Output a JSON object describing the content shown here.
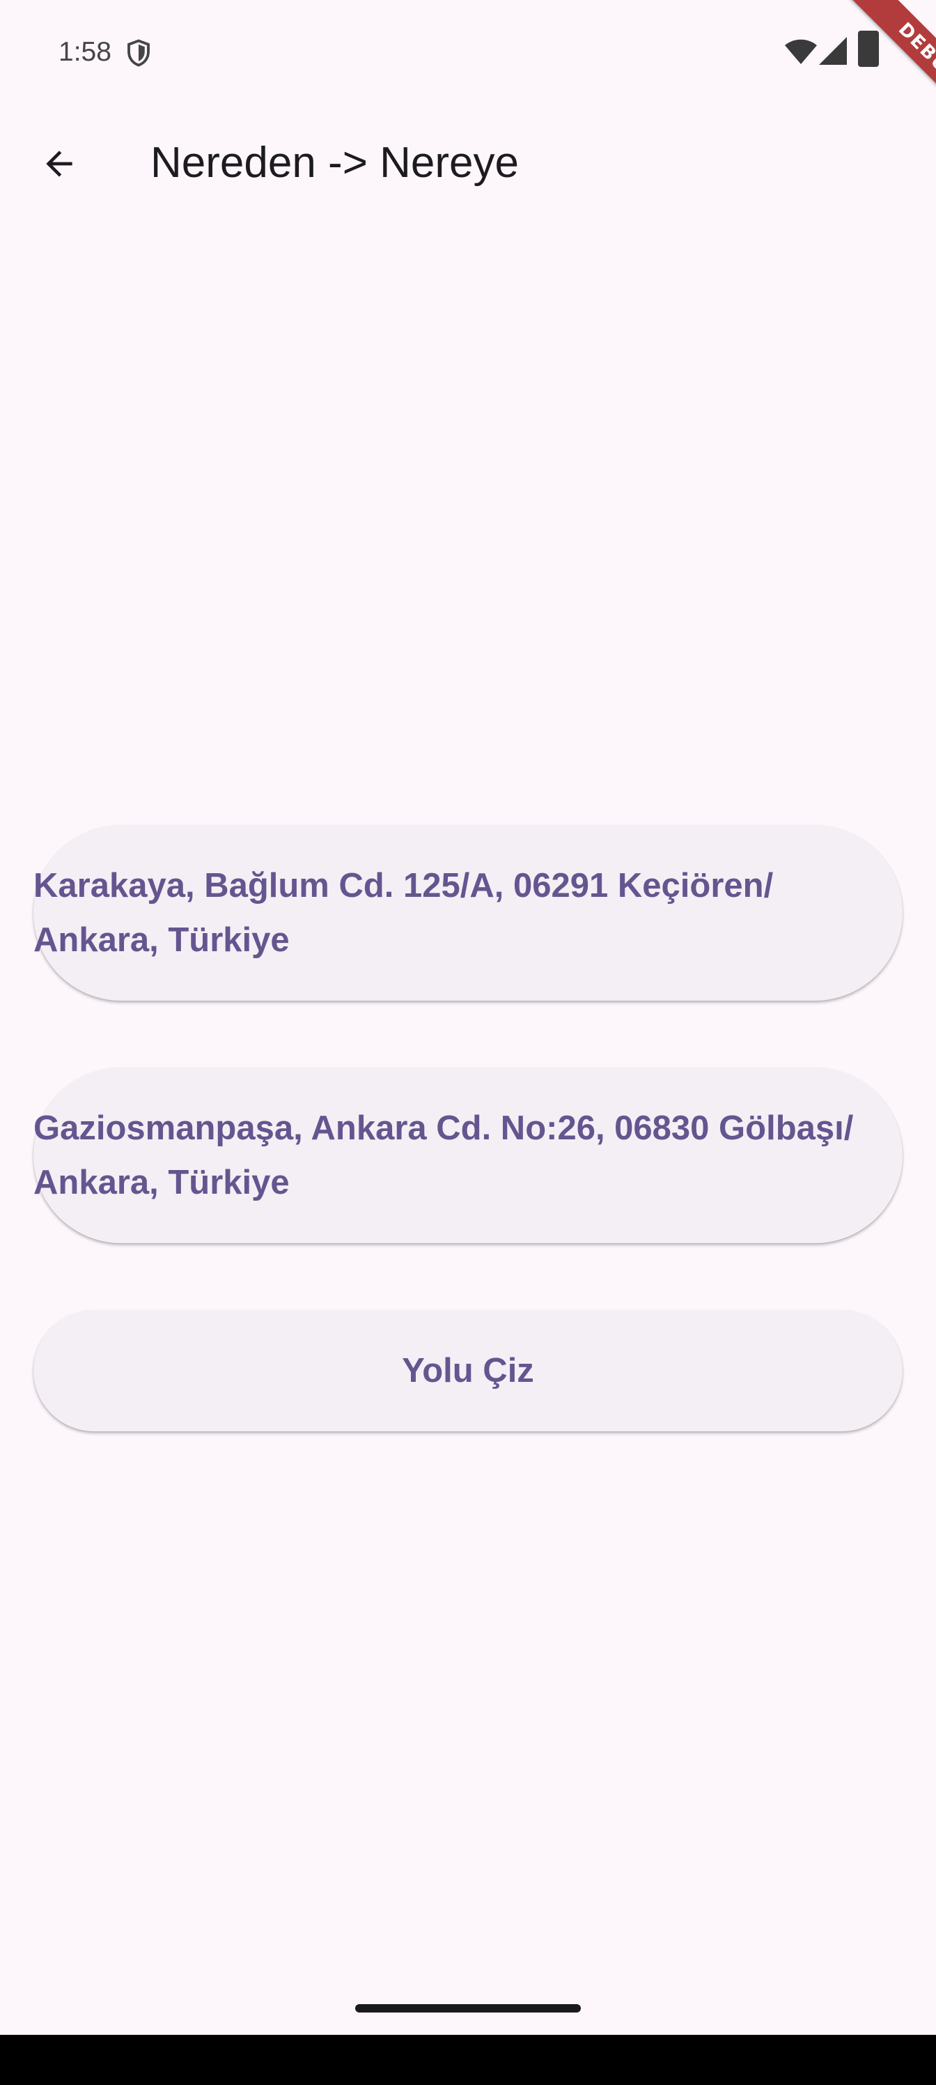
{
  "status_bar": {
    "time": "1:58",
    "icons": [
      "shield-icon",
      "wifi-icon",
      "signal-icon",
      "battery-icon"
    ]
  },
  "debug_banner": "DEBUG",
  "app_bar": {
    "back_icon": "arrow-back-icon",
    "title": "Nereden -> Nereye"
  },
  "form": {
    "from_address": "Karakaya, Bağlum Cd. 125/A, 06291 Keçiören/ Ankara, Türkiye",
    "to_address": "Gaziosmanpaşa, Ankara Cd. No:26, 06830 Gölbaşı/ Ankara, Türkiye",
    "draw_route_label": "Yolu Çiz"
  },
  "colors": {
    "background": "#fdf7fc",
    "pill_background": "#f4eff5",
    "accent_text": "#65558f",
    "debug_ribbon": "#b23c3c"
  }
}
